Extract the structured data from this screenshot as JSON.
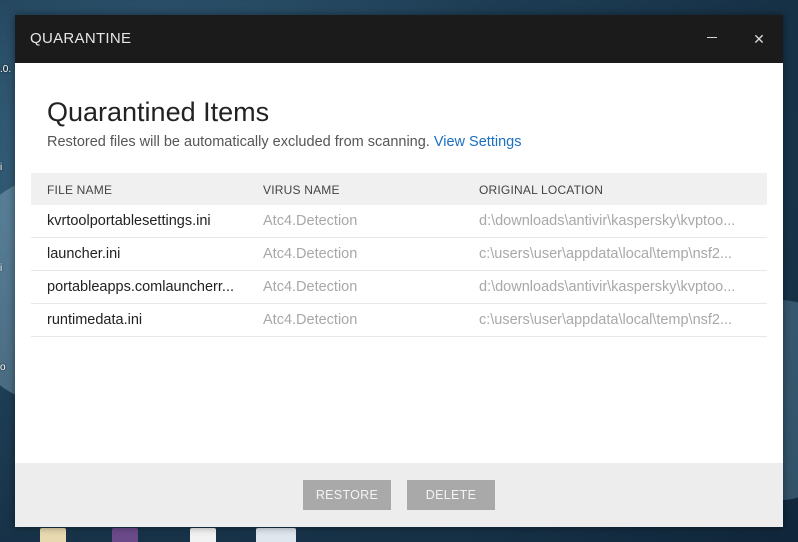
{
  "window": {
    "title": "QUARANTINE",
    "minimize_glyph": "—",
    "close_glyph": "✕"
  },
  "main": {
    "heading": "Quarantined Items",
    "subtitle": "Restored files will be automatically excluded from scanning.",
    "link": "View Settings"
  },
  "table": {
    "headers": [
      "FILE NAME",
      "VIRUS NAME",
      "ORIGINAL LOCATION"
    ],
    "rows": [
      {
        "file": "kvrtoolportablesettings.ini",
        "virus": "Atc4.Detection",
        "location": "d:\\downloads\\antivir\\kaspersky\\kvptoo..."
      },
      {
        "file": "launcher.ini",
        "virus": "Atc4.Detection",
        "location": "c:\\users\\user\\appdata\\local\\temp\\nsf2..."
      },
      {
        "file": "portableapps.comlauncherr...",
        "virus": "Atc4.Detection",
        "location": "d:\\downloads\\antivir\\kaspersky\\kvptoo..."
      },
      {
        "file": "runtimedata.ini",
        "virus": "Atc4.Detection",
        "location": "c:\\users\\user\\appdata\\local\\temp\\nsf2..."
      }
    ]
  },
  "footer": {
    "restore_label": "RESTORE",
    "delete_label": "DELETE"
  },
  "colors": {
    "titlebar": "#1b1b1b",
    "link": "#1a6fc0",
    "button_disabled": "#a9a9a9"
  }
}
